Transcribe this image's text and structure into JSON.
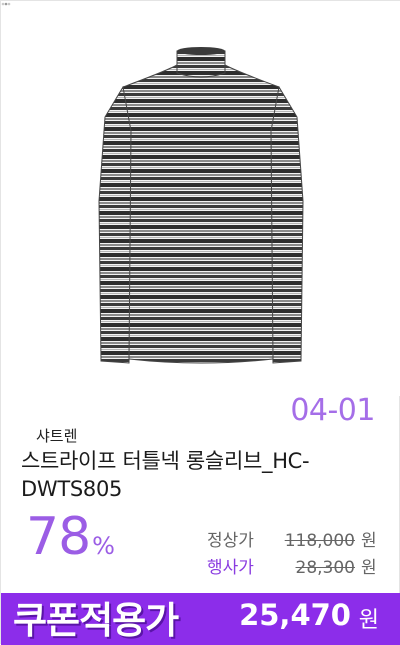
{
  "event_date": "04-01",
  "brand": "샤트렌",
  "product_name": "스트라이프 터틀넥 롱슬리브_HC-DWTS805",
  "discount": {
    "value": "78",
    "unit": "%"
  },
  "regular_price": {
    "label": "정상가",
    "amount": "118,000",
    "unit": "원"
  },
  "event_price": {
    "label": "행사가",
    "amount": "28,300",
    "unit": "원"
  },
  "coupon": {
    "label": "쿠폰적용가",
    "amount": "25,470",
    "unit": "원"
  },
  "colors": {
    "accent": "#9b5de5",
    "coupon_bg": "#8c2dea"
  },
  "image": {
    "icon": "striped-turtleneck-image"
  }
}
